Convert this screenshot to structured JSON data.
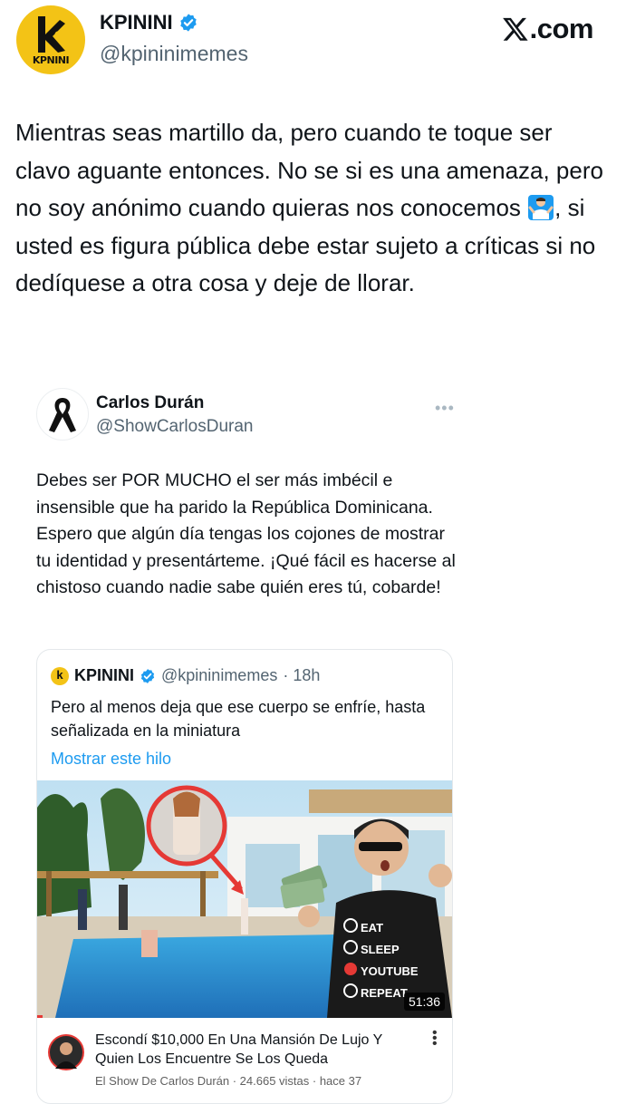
{
  "account": {
    "name": "KPININI",
    "handle": "@kpininimemes",
    "avatar_word": "KPNINI"
  },
  "site": {
    "label": ".com"
  },
  "tweet": {
    "text_before_emoji": "Mientras seas martillo da, pero cuando te toque ser clavo aguante entonces. No se si es una amenaza, pero no soy anónimo cuando quieras nos conocemos ",
    "emoji": "man-shrugging",
    "text_after_emoji": ", si usted es figura pública debe estar sujeto a críticas si no dedíquese a otra cosa y deje de llorar."
  },
  "embedded": {
    "name": "Carlos Durán",
    "handle": "@ShowCarlosDuran",
    "more": "•••",
    "text": "Debes ser POR MUCHO el ser más imbécil e insensible que ha parido la República Dominicana. Espero que algún día tengas los cojones de mostrar tu identidad y presentárteme. ¡Qué fácil es hacerse al chistoso cuando nadie sabe quién eres tú, cobarde!",
    "quote": {
      "avatar_letter": "k",
      "name": "KPININI",
      "handle": "@kpininimemes",
      "time": "· 18h",
      "text": "Pero al menos deja que ese cuerpo se enfríe, hasta señalizada en la miniatura",
      "link": "Mostrar este hilo",
      "video": {
        "duration": "51:36",
        "shirt": [
          "EAT",
          "SLEEP",
          "YOUTUBE",
          "REPEAT"
        ],
        "title": "Escondí $10,000 En Una Mansión De Lujo Y Quien Los Encuentre Se Los Queda",
        "meta": "El Show De Carlos Durán · 24.665 vistas · hace 37"
      }
    }
  },
  "colors": {
    "link": "#1d9bf0",
    "verified": "#1d9bf0",
    "secondary_text": "#536471",
    "avatar_yellow": "#f3c316"
  }
}
